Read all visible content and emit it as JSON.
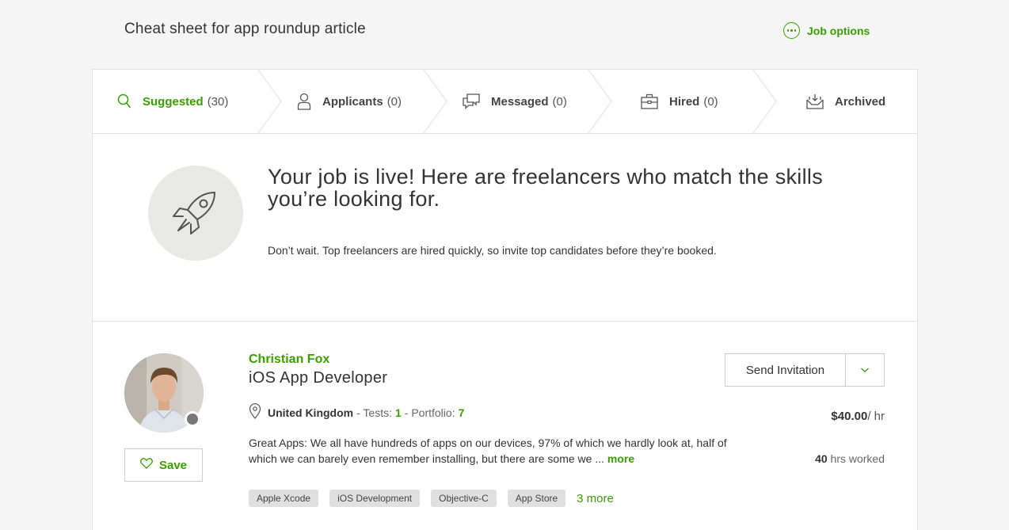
{
  "header": {
    "title": "Cheat sheet for app roundup article",
    "job_options_label": "Job options"
  },
  "tabs": [
    {
      "label": "Suggested",
      "count": "(30)",
      "icon": "search-icon",
      "active": true
    },
    {
      "label": "Applicants",
      "count": "(0)",
      "icon": "user-icon",
      "active": false
    },
    {
      "label": "Messaged",
      "count": "(0)",
      "icon": "chat-icon",
      "active": false
    },
    {
      "label": "Hired",
      "count": "(0)",
      "icon": "briefcase-icon",
      "active": false
    },
    {
      "label": "Archived",
      "count": "",
      "icon": "archive-icon",
      "active": false
    }
  ],
  "hero": {
    "headline": "Your job is live! Here are freelancers who match the skills you’re looking for.",
    "subtext": "Don’t wait. Top freelancers are hired quickly, so invite top candidates before they’re booked.",
    "icon": "rocket-icon"
  },
  "freelancer": {
    "name": "Christian Fox",
    "title": "iOS App Developer",
    "country": "United Kingdom",
    "tests_label": "- Tests:",
    "tests_value": "1",
    "portfolio_label": "- Portfolio:",
    "portfolio_value": "7",
    "description": "Great Apps: We all have hundreds of apps on our devices, 97% of which we hardly look at, half of which we can barely even remember installing, but there are some we ...",
    "more_label": "more",
    "skills": [
      "Apple Xcode",
      "iOS Development",
      "Objective-C",
      "App Store"
    ],
    "skills_more": "3 more",
    "save_label": "Save",
    "invite_label": "Send Invitation",
    "rate": "$40.00",
    "rate_unit": "/ hr",
    "hours_value": "40",
    "hours_label": "hrs worked"
  },
  "colors": {
    "accent": "#37a000",
    "background": "#f5f5f5",
    "border": "#e0e0e0"
  }
}
